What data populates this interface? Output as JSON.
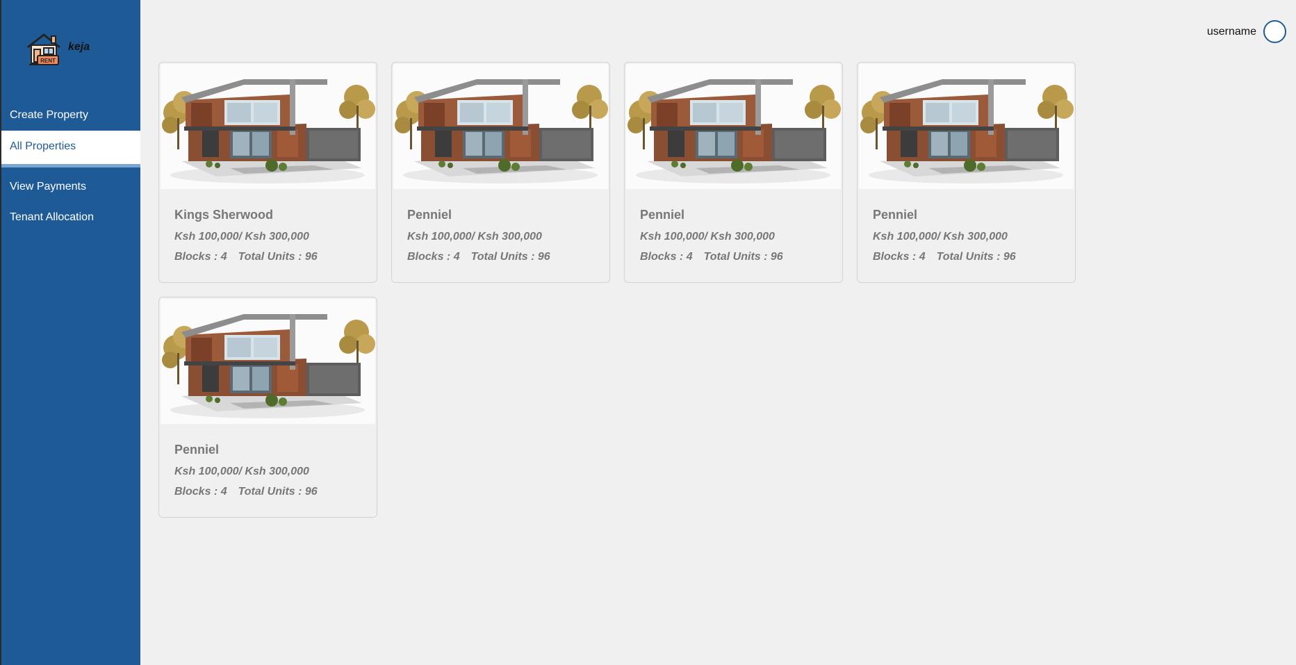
{
  "app": {
    "brand": "keja",
    "logo_badge": "RENT"
  },
  "sidebar": {
    "items": [
      {
        "label": "Create Property",
        "active": false
      },
      {
        "label": "All Properties",
        "active": true
      },
      {
        "label": "View Payments",
        "active": false
      },
      {
        "label": "Tenant Allocation",
        "active": false
      }
    ]
  },
  "header": {
    "username": "username"
  },
  "properties": [
    {
      "name": "Kings Sherwood",
      "price": "Ksh 100,000/ Ksh 300,000",
      "blocks": "Blocks : 4",
      "units": "Total Units : 96"
    },
    {
      "name": "Penniel",
      "price": "Ksh 100,000/ Ksh 300,000",
      "blocks": "Blocks : 4",
      "units": "Total Units : 96"
    },
    {
      "name": "Penniel",
      "price": "Ksh 100,000/ Ksh 300,000",
      "blocks": "Blocks : 4",
      "units": "Total Units : 96"
    },
    {
      "name": "Penniel",
      "price": "Ksh 100,000/ Ksh 300,000",
      "blocks": "Blocks : 4",
      "units": "Total Units : 96"
    },
    {
      "name": "Penniel",
      "price": "Ksh 100,000/ Ksh 300,000",
      "blocks": "Blocks : 4",
      "units": "Total Units : 96"
    }
  ],
  "colors": {
    "sidebar": "#1e5b96",
    "background": "#f0f0f0",
    "card_text": "#777777"
  },
  "icons": {
    "logo": "house-rent-logo-icon",
    "avatar": "user-avatar-icon"
  }
}
